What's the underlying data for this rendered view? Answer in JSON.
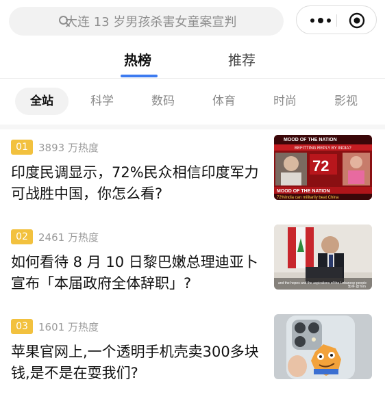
{
  "search": {
    "placeholder": "大连 13 岁男孩杀害女童案宣判"
  },
  "tabs": [
    {
      "label": "热榜",
      "active": true
    },
    {
      "label": "推荐",
      "active": false
    }
  ],
  "categories": [
    "全站",
    "科学",
    "数码",
    "体育",
    "时尚",
    "影视"
  ],
  "items": [
    {
      "rank": "01",
      "heat": "3893 万热度",
      "title": "印度民调显示，72%民众相信印度军力可战胜中国，你怎么看?",
      "thumb": {
        "headline": "MOOD OF THE NATION",
        "subhead": "BEFITTING REPLY BY INDIA?",
        "big": "72",
        "ticker_top": "MOOD OF THE NATION",
        "ticker_bottom": "72%India can militarily beat China"
      }
    },
    {
      "rank": "02",
      "heat": "2461 万热度",
      "title": "如何看待 8 月 10 日黎巴嫩总理迪亚卜宣布「本届政府全体辞职」?",
      "thumb": {
        "subtitle": "and the hopes and the aspirations of the Lebanese people",
        "watermark": "知乎 @Tom"
      }
    },
    {
      "rank": "03",
      "heat": "1601 万热度",
      "title": "苹果官网上,一个透明手机壳卖300多块钱,是不是在耍我们?",
      "thumb": {}
    }
  ]
}
